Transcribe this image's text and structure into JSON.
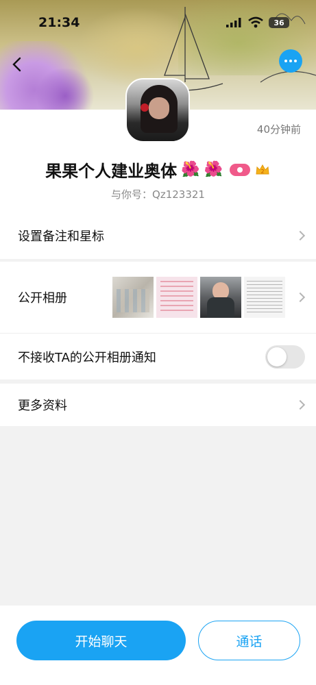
{
  "status_bar": {
    "time": "21:34",
    "battery": "36"
  },
  "profile": {
    "time_ago": "40分钟前",
    "name": "果果个人建业奥体",
    "name_flowers": [
      "🌺",
      "🌺"
    ],
    "crown_level": "2",
    "account_label": "与你号：",
    "account_id": "Qz123321"
  },
  "cells": {
    "remark_label": "设置备注和星标",
    "album_label": "公开相册",
    "notify_label": "不接收TA的公开相册通知",
    "notify_enabled": false,
    "more_label": "更多资料"
  },
  "album": {
    "thumbnail_count": 4
  },
  "actions": {
    "chat_label": "开始聊天",
    "call_label": "通话"
  },
  "colors": {
    "accent": "#1aa3f3",
    "background": "#f2f2f2"
  }
}
